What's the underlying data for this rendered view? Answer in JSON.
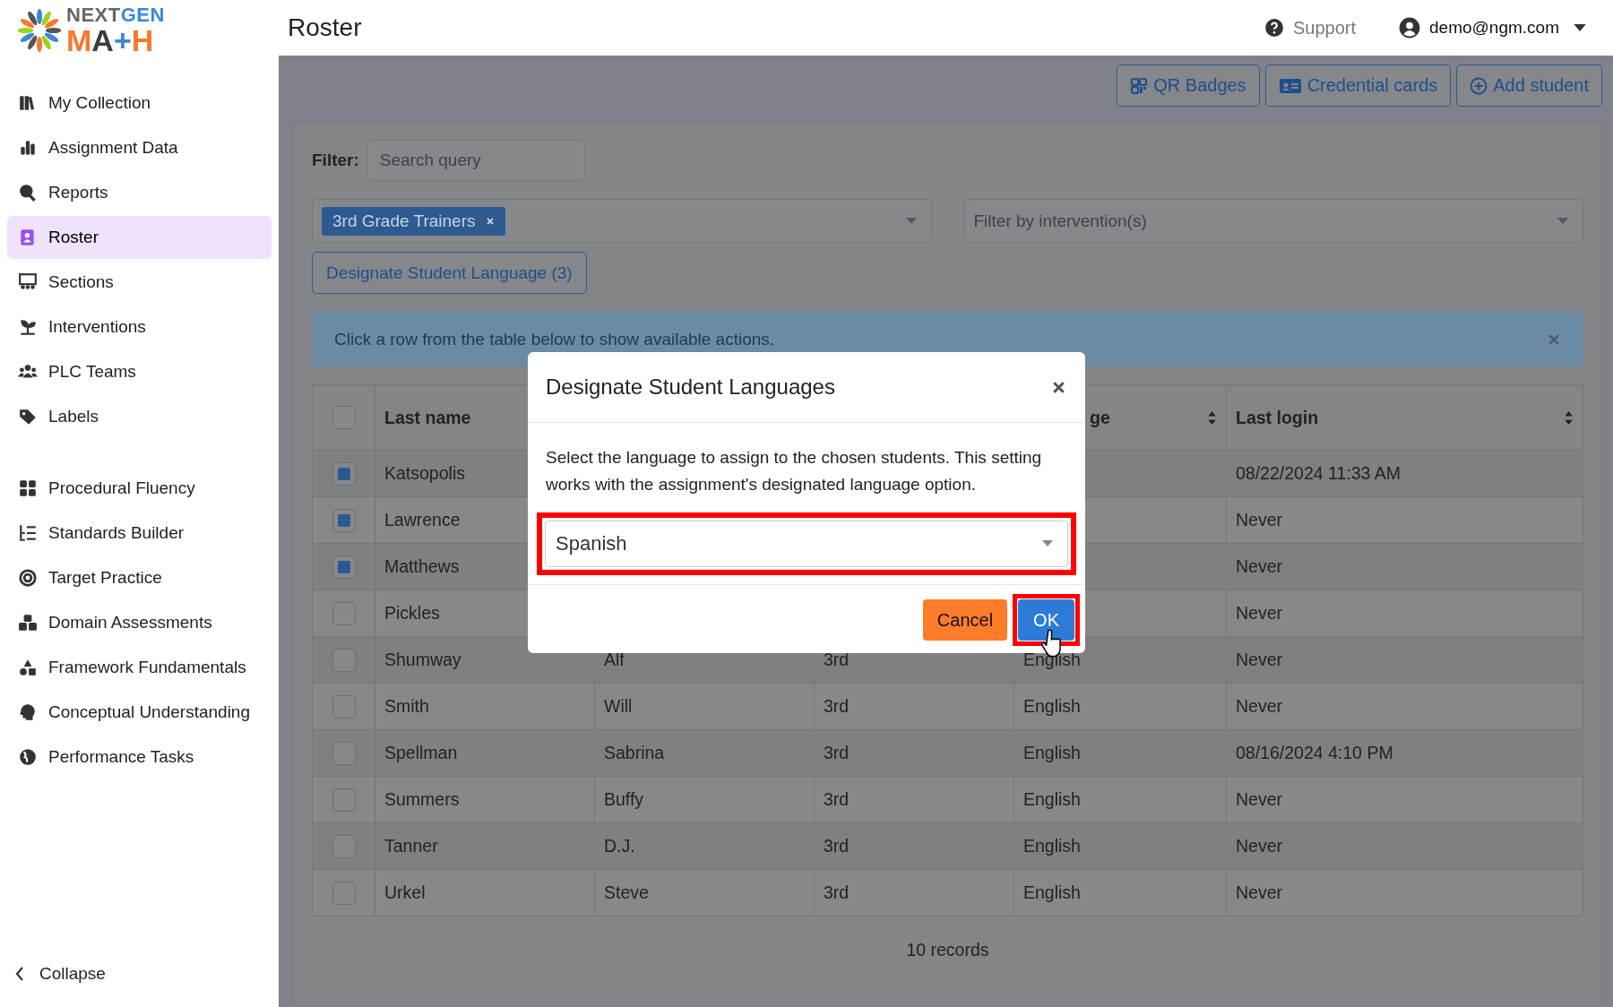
{
  "logo": {
    "top": [
      "NEXT",
      "GEN"
    ],
    "bottom": "MA+H"
  },
  "sidebar": {
    "primary_items": [
      {
        "label": "My Collection",
        "selected": false
      },
      {
        "label": "Assignment Data",
        "selected": false
      },
      {
        "label": "Reports",
        "selected": false
      },
      {
        "label": "Roster",
        "selected": true
      },
      {
        "label": "Sections",
        "selected": false
      },
      {
        "label": "Interventions",
        "selected": false
      },
      {
        "label": "PLC Teams",
        "selected": false
      },
      {
        "label": "Labels",
        "selected": false
      }
    ],
    "program_items": [
      {
        "label": "Procedural Fluency",
        "selected": false
      },
      {
        "label": "Standards Builder",
        "selected": false
      },
      {
        "label": "Target Practice",
        "selected": false
      },
      {
        "label": "Domain Assessments",
        "selected": false
      },
      {
        "label": "Framework Fundamentals",
        "selected": false
      },
      {
        "label": "Conceptual Understanding",
        "selected": false
      },
      {
        "label": "Performance Tasks",
        "selected": false
      }
    ],
    "collapse": "Collapse"
  },
  "header": {
    "title": "Roster",
    "support": "Support",
    "user": "demo@ngm.com"
  },
  "toolbar": [
    "QR Badges",
    "Credential cards",
    "Add student"
  ],
  "filter": {
    "label": "Filter:",
    "placeholder": "Search query"
  },
  "class_select": {
    "tags": [
      "3rd Grade Trainers"
    ]
  },
  "intervention_select": {
    "placeholder": "Filter by intervention(s)"
  },
  "designate_button": "Designate Student Language (3)",
  "alert": {
    "text": "Click a row from the table below to show available actions."
  },
  "table": {
    "select_all_checked": false,
    "columns": [
      {
        "label": "Last name"
      },
      {
        "label": "ge",
        "sortable": true
      },
      {
        "label": "Last login",
        "sortable": true
      }
    ],
    "rows": [
      {
        "selected": true,
        "last_name": "Katsopolis",
        "last_login": "08/22/2024 11:33 AM"
      },
      {
        "selected": true,
        "last_name": "Lawrence",
        "last_login": "Never"
      },
      {
        "selected": true,
        "last_name": "Matthews",
        "last_login": "Never"
      },
      {
        "selected": false,
        "last_name": "Pickles",
        "last_login": "Never"
      },
      {
        "selected": false,
        "last_name": "Shumway",
        "first_name": "Alf",
        "grade": "3rd",
        "language": "English",
        "last_login": "Never"
      },
      {
        "selected": false,
        "last_name": "Smith",
        "first_name": "Will",
        "grade": "3rd",
        "language": "English",
        "last_login": "Never"
      },
      {
        "selected": false,
        "last_name": "Spellman",
        "first_name": "Sabrina",
        "grade": "3rd",
        "language": "English",
        "last_login": "08/16/2024 4:10 PM"
      },
      {
        "selected": false,
        "last_name": "Summers",
        "first_name": "Buffy",
        "grade": "3rd",
        "language": "English",
        "last_login": "Never"
      },
      {
        "selected": false,
        "last_name": "Tanner",
        "first_name": "D.J.",
        "grade": "3rd",
        "language": "English",
        "last_login": "Never"
      },
      {
        "selected": false,
        "last_name": "Urkel",
        "first_name": "Steve",
        "grade": "3rd",
        "language": "English",
        "last_login": "Never"
      }
    ],
    "footer": "10 records"
  },
  "modal": {
    "title": "Designate Student Languages",
    "text": "Select the language to assign to the chosen students. This setting works with the assignment's designated language option.",
    "language": {
      "value": "Spanish",
      "highlighted": true
    },
    "buttons": [
      {
        "kind": "cancel",
        "label": "Cancel",
        "highlighted": false
      },
      {
        "kind": "ok",
        "label": "OK",
        "highlighted": true
      }
    ]
  }
}
